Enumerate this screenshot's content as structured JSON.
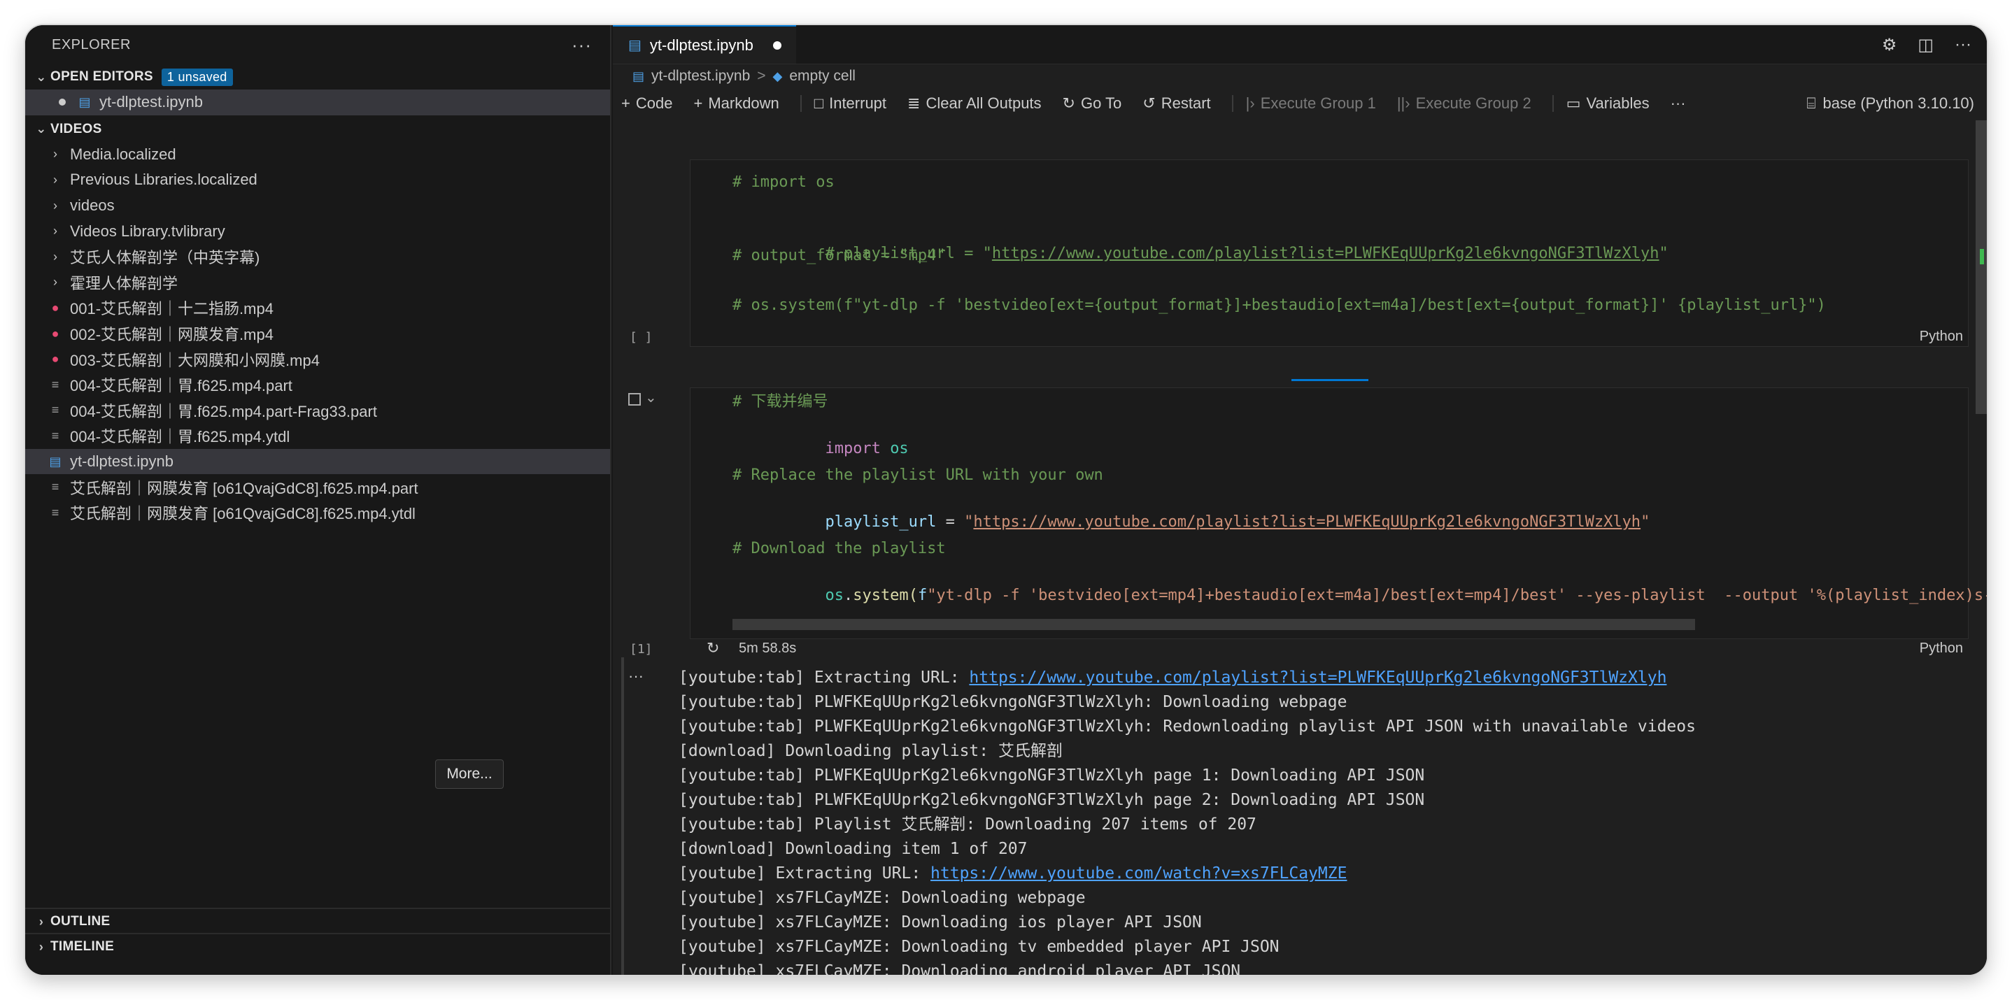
{
  "sidebar": {
    "title": "EXPLORER",
    "more": "···",
    "open_editors": {
      "label": "OPEN EDITORS",
      "badge": "1 unsaved",
      "items": [
        {
          "label": "yt-dlptest.ipynb"
        }
      ]
    },
    "videos": {
      "label": "VIDEOS",
      "items": [
        {
          "label": "Media.localized",
          "type": "folder"
        },
        {
          "label": "Previous Libraries.localized",
          "type": "folder"
        },
        {
          "label": "videos",
          "type": "folder"
        },
        {
          "label": "Videos Library.tvlibrary",
          "type": "folder"
        },
        {
          "label": "艾氏人体解剖学（中英字幕)",
          "type": "folder"
        },
        {
          "label": "霍理人体解剖学",
          "type": "folder"
        },
        {
          "label": "001-艾氏解剖｜十二指肠.mp4",
          "type": "video"
        },
        {
          "label": "002-艾氏解剖｜网膜发育.mp4",
          "type": "video"
        },
        {
          "label": "003-艾氏解剖｜大网膜和小网膜.mp4",
          "type": "video"
        },
        {
          "label": "004-艾氏解剖｜胃.f625.mp4.part",
          "type": "file"
        },
        {
          "label": "004-艾氏解剖｜胃.f625.mp4.part-Frag33.part",
          "type": "file"
        },
        {
          "label": "004-艾氏解剖｜胃.f625.mp4.ytdl",
          "type": "file"
        },
        {
          "label": "yt-dlptest.ipynb",
          "type": "notebook"
        },
        {
          "label": "艾氏解剖｜网膜发育 [o61QvajGdC8].f625.mp4.part",
          "type": "file"
        },
        {
          "label": "艾氏解剖｜网膜发育 [o61QvajGdC8].f625.mp4.ytdl",
          "type": "file"
        }
      ]
    },
    "more_button": "More...",
    "outline": "OUTLINE",
    "timeline": "TIMELINE"
  },
  "editor": {
    "tab": {
      "label": "yt-dlptest.ipynb"
    },
    "breadcrumb": {
      "file": "yt-dlptest.ipynb",
      "sep": ">",
      "cell": "empty cell"
    },
    "toolbar": {
      "code": "Code",
      "markdown": "Markdown",
      "interrupt": "Interrupt",
      "clear": "Clear All Outputs",
      "goto": "Go To",
      "restart": "Restart",
      "exec1": "Execute Group 1",
      "exec2": "Execute Group 2",
      "variables": "Variables",
      "more": "···",
      "kernel": "base (Python 3.10.10)"
    },
    "cell1": {
      "exec": "[ ]",
      "lang": "Python",
      "l1": "# import os",
      "l2a": "# playlist_url = \"",
      "l2url": "https://www.youtube.com/playlist?list=PLWFKEqUUprKg2le6kvngoNGF3TlWzXlyh",
      "l2b": "\"",
      "l3": "# output_format = \"mp4\"",
      "l4": "# os.system(f\"yt-dlp -f 'bestvideo[ext={output_format}]+bestaudio[ext=m4a]/best[ext={output_format}]' {playlist_url}\")"
    },
    "cell2": {
      "exec": "[1]",
      "time": "5m 58.8s",
      "lang": "Python",
      "l1": "# 下载并编号",
      "l2kw": "import",
      "l2mod": "os",
      "l3": "# Replace the playlist URL with your own",
      "l4var": "playlist_url",
      "l4eq": " = ",
      "l4q1": "\"",
      "l4url": "https://www.youtube.com/playlist?list=PLWFKEqUUprKg2le6kvngoNGF3TlWzXlyh",
      "l4q2": "\"",
      "l5": "# Download the playlist",
      "l6mod": "os",
      "l6dot": ".",
      "l6fn": "system",
      "l6paren": "(",
      "l6f": "f",
      "l6str": "\"yt-dlp -f 'bestvideo[ext=mp4]+bestaudio[ext=m4a]/best[ext=mp4]/best' --yes-playlist  --output '%(playlist_index)s-%(t"
    },
    "output": {
      "dots": "···",
      "l1a": "[youtube:tab] Extracting URL: ",
      "l1url": "https://www.youtube.com/playlist?list=PLWFKEqUUprKg2le6kvngoNGF3TlWzXlyh",
      "l2": "[youtube:tab] PLWFKEqUUprKg2le6kvngoNGF3TlWzXlyh: Downloading webpage",
      "l3": "[youtube:tab] PLWFKEqUUprKg2le6kvngoNGF3TlWzXlyh: Redownloading playlist API JSON with unavailable videos",
      "l4": "[download] Downloading playlist: 艾氏解剖",
      "l5": "[youtube:tab] PLWFKEqUUprKg2le6kvngoNGF3TlWzXlyh page 1: Downloading API JSON",
      "l6": "[youtube:tab] PLWFKEqUUprKg2le6kvngoNGF3TlWzXlyh page 2: Downloading API JSON",
      "l7": "[youtube:tab] Playlist 艾氏解剖: Downloading 207 items of 207",
      "l8": "[download] Downloading item 1 of 207",
      "l9a": "[youtube] Extracting URL: ",
      "l9url": "https://www.youtube.com/watch?v=xs7FLCayMZE",
      "l10": "[youtube] xs7FLCayMZE: Downloading webpage",
      "l11": "[youtube] xs7FLCayMZE: Downloading ios player API JSON",
      "l12": "[youtube] xs7FLCayMZE: Downloading tv embedded player API JSON",
      "l13": "[youtube] xs7FLCayMZE: Downloading android player API JSON"
    }
  }
}
